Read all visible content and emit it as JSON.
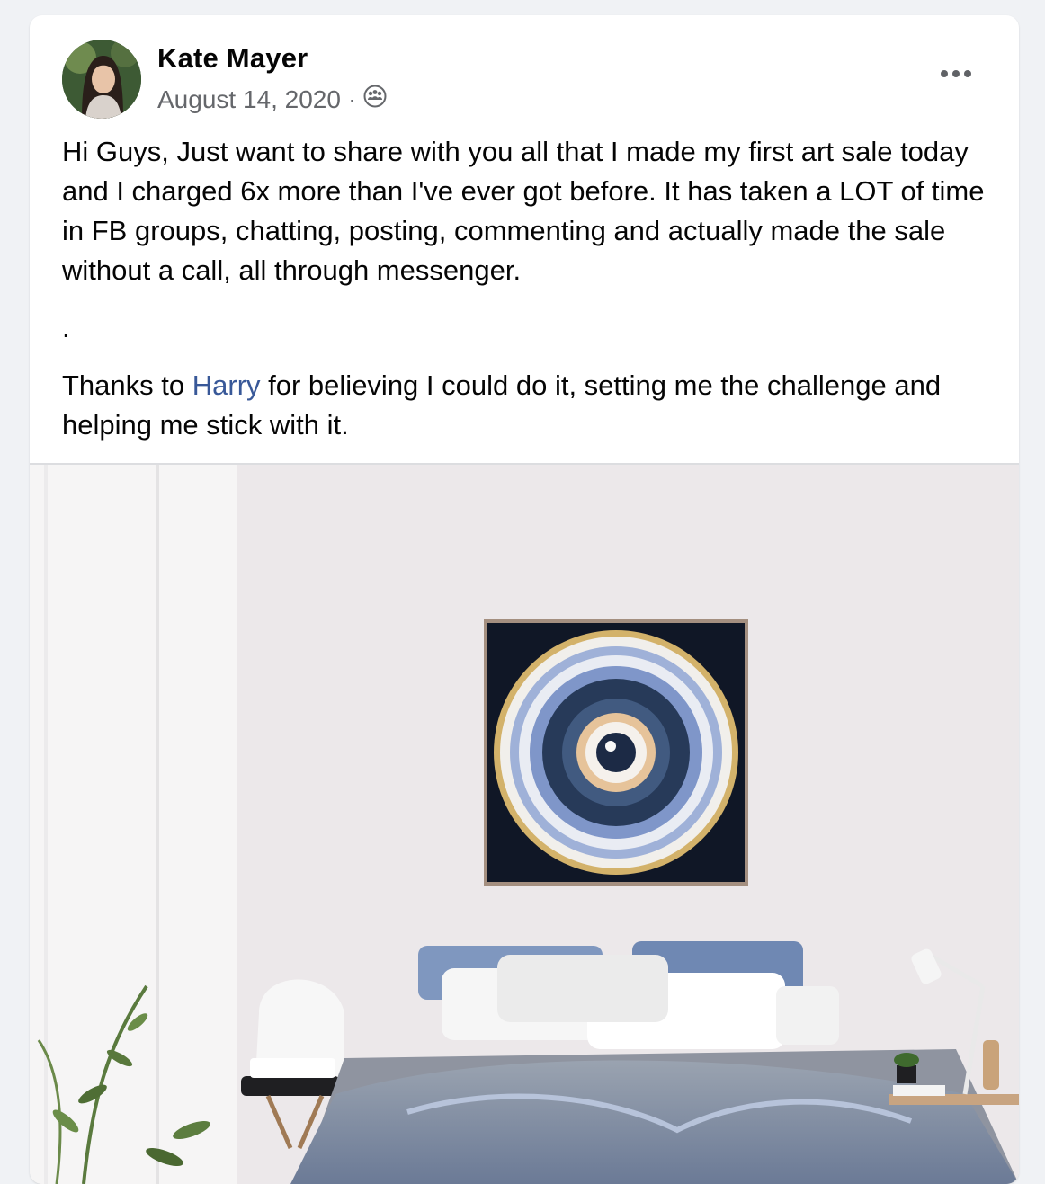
{
  "post": {
    "author": "Kate Mayer",
    "date": "August 14, 2020",
    "separator": "·",
    "audience_icon": "group-icon",
    "menu_icon": "more-options-icon",
    "paragraphs": {
      "p1": "Hi Guys, Just want to share with you all that I made my first art sale today and I charged 6x more than I've ever got before. It has taken a LOT of time in FB groups, chatting, posting, commenting and actually made the sale without a call, all through messenger.",
      "p2": ".",
      "p3_before": "Thanks to ",
      "p3_mention": "Harry",
      "p3_after": " for believing I could do it, setting me the challenge and helping me stick with it."
    }
  },
  "colors": {
    "link": "#385898",
    "secondary_text": "#65676b"
  }
}
